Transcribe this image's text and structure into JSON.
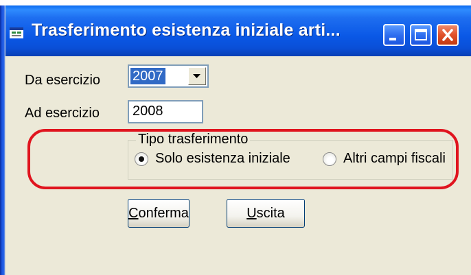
{
  "window": {
    "title": "Trasferimento esistenza iniziale arti...",
    "icon": "app-window-icon",
    "controls": [
      "minimize-icon",
      "maximize-icon",
      "close-icon"
    ]
  },
  "form": {
    "da_esercizio_label": "Da esercizio",
    "da_esercizio_value": "2007",
    "ad_esercizio_label": "Ad esercizio",
    "ad_esercizio_value": "2008"
  },
  "tipo_trasferimento": {
    "legend": "Tipo trasferimento",
    "options": [
      {
        "label": "Solo esistenza iniziale",
        "checked": true
      },
      {
        "label": "Altri campi fiscali",
        "checked": false
      }
    ]
  },
  "buttons": {
    "conferma": {
      "mnemonic": "C",
      "rest": "onferma"
    },
    "uscita": {
      "mnemonic": "U",
      "rest": "scita"
    }
  },
  "colors": {
    "highlight": "#e0141e",
    "titlebar": "#0a58e6",
    "dialog_bg": "#ece9d8",
    "selection": "#316ac5"
  }
}
